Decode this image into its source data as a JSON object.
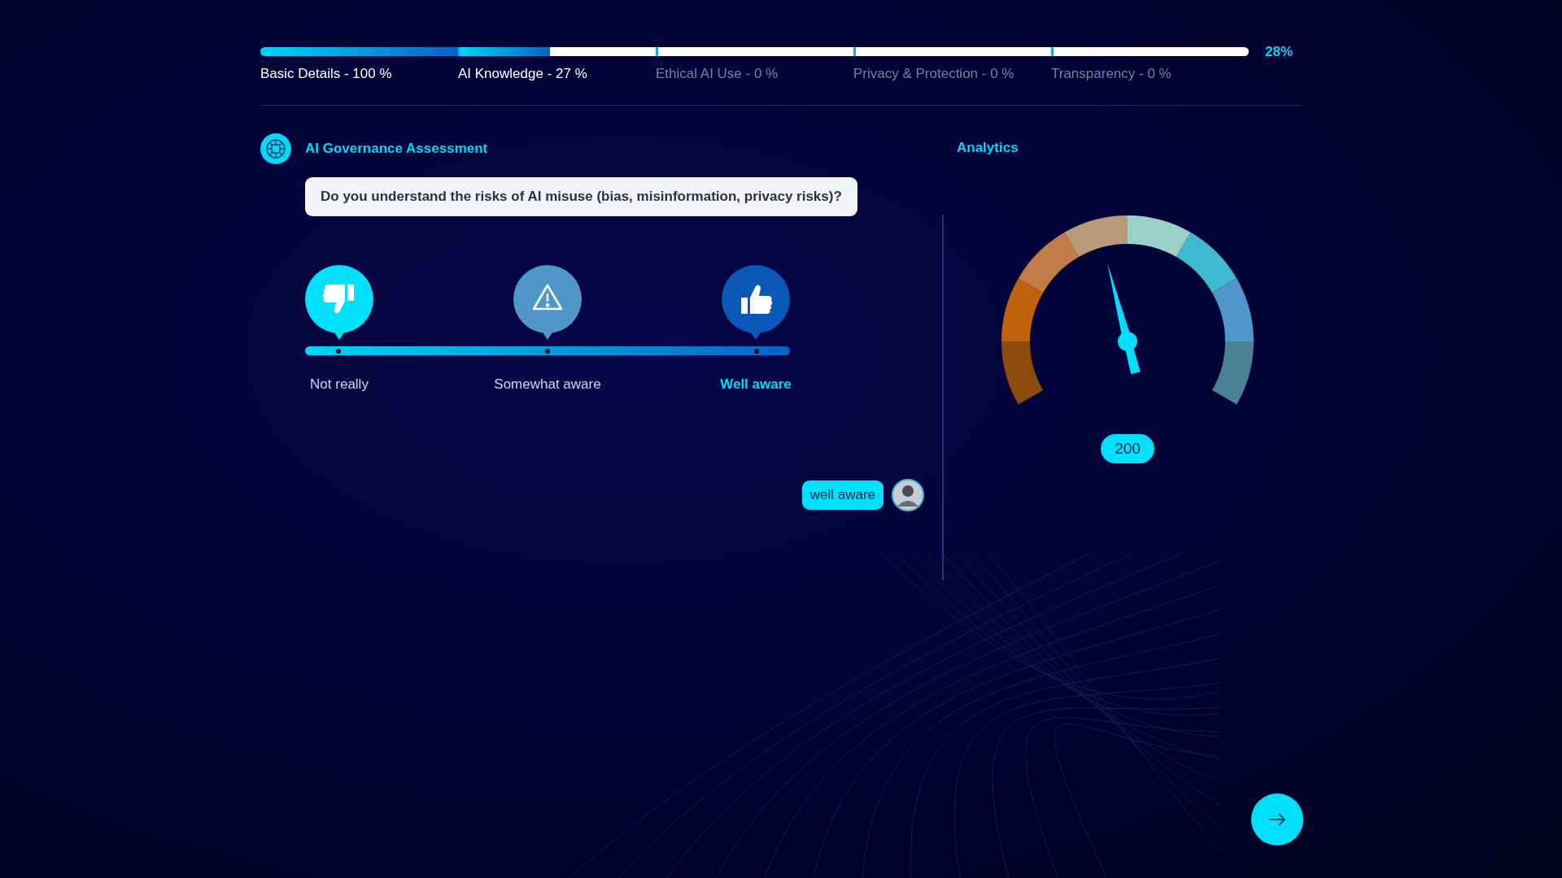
{
  "progress": {
    "percent": "28%",
    "sections": [
      {
        "label": "Basic Details - 100 %",
        "level": 1,
        "active": true
      },
      {
        "label": "AI Knowledge - 27 %",
        "level": 0.46,
        "active": true
      },
      {
        "label": "Ethical AI Use - 0 %",
        "active": false
      },
      {
        "label": "Privacy & Protection - 0 %",
        "active": false
      },
      {
        "label": "Transparency - 0 %",
        "active": false
      }
    ]
  },
  "assessment": {
    "title": "AI Governance Assessment",
    "question": "Do you understand the risks of AI misuse (bias, misinformation, privacy risks)?",
    "options": [
      {
        "kind": "thumbs_down",
        "label": "Not really",
        "selected": false
      },
      {
        "kind": "warning",
        "label": "Somewhat aware",
        "selected": false
      },
      {
        "kind": "thumbs_up",
        "label": "Well aware",
        "selected": true
      }
    ],
    "answer": "well aware"
  },
  "analytics": {
    "title": "Analytics",
    "gauge": {
      "level": 0.44,
      "value": "200"
    }
  }
}
